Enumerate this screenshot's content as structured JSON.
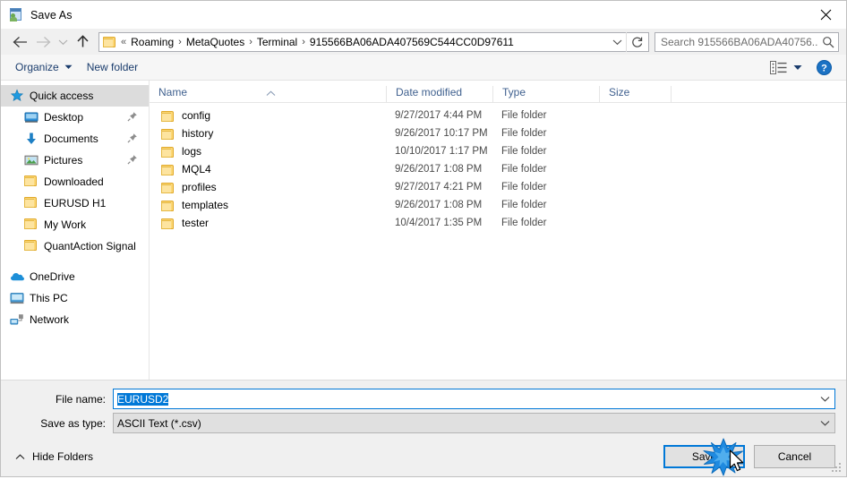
{
  "window": {
    "title": "Save As",
    "icon": "save-as-icon",
    "close_label": "✕"
  },
  "navigation": {
    "back_icon": "back-arrow-icon",
    "forward_icon": "forward-arrow-icon",
    "recent_icon": "chevron-down-icon",
    "up_icon": "up-arrow-icon",
    "folder_icon": "folder-icon",
    "breadcrumb": [
      {
        "label": "«",
        "type": "overflow"
      },
      {
        "label": "Roaming",
        "type": "crumb"
      },
      {
        "label": "MetaQuotes",
        "type": "crumb"
      },
      {
        "label": "Terminal",
        "type": "crumb"
      },
      {
        "label": "915566BA06ADA407569C544CC0D97611",
        "type": "crumb"
      }
    ],
    "dropdown_icon": "chevron-down-icon",
    "refresh_icon": "refresh-icon"
  },
  "search": {
    "placeholder": "Search 915566BA06ADA40756...",
    "icon": "search-icon"
  },
  "toolbar": {
    "organize_label": "Organize",
    "organize_icon": "chevron-down-icon",
    "new_folder_label": "New folder",
    "view_icon": "view-layout-icon",
    "view_chevron": "chevron-down-icon",
    "help_icon": "help-icon"
  },
  "sidebar": {
    "items": [
      {
        "label": "Quick access",
        "icon": "star-icon",
        "level": "root",
        "selected": true,
        "pinned": false
      },
      {
        "label": "Desktop",
        "icon": "desktop-icon",
        "level": "child",
        "selected": false,
        "pinned": true
      },
      {
        "label": "Documents",
        "icon": "documents-icon",
        "level": "child",
        "selected": false,
        "pinned": true
      },
      {
        "label": "Pictures",
        "icon": "pictures-icon",
        "level": "child",
        "selected": false,
        "pinned": true
      },
      {
        "label": "Downloaded",
        "icon": "folder-icon",
        "level": "child",
        "selected": false,
        "pinned": false
      },
      {
        "label": "EURUSD H1",
        "icon": "folder-icon",
        "level": "child",
        "selected": false,
        "pinned": false
      },
      {
        "label": "My Work",
        "icon": "folder-icon",
        "level": "child",
        "selected": false,
        "pinned": false
      },
      {
        "label": "QuantAction Signal",
        "icon": "folder-icon",
        "level": "child",
        "selected": false,
        "pinned": false
      },
      {
        "label": "OneDrive",
        "icon": "onedrive-icon",
        "level": "root",
        "selected": false,
        "pinned": false
      },
      {
        "label": "This PC",
        "icon": "thispc-icon",
        "level": "root",
        "selected": false,
        "pinned": false
      },
      {
        "label": "Network",
        "icon": "network-icon",
        "level": "root",
        "selected": false,
        "pinned": false
      }
    ]
  },
  "filelist": {
    "columns": [
      "Name",
      "Date modified",
      "Type",
      "Size"
    ],
    "sort_column": "Name",
    "sort_direction": "ascending",
    "rows": [
      {
        "name": "config",
        "date": "9/27/2017 4:44 PM",
        "type": "File folder",
        "size": "",
        "icon": "folder-icon"
      },
      {
        "name": "history",
        "date": "9/26/2017 10:17 PM",
        "type": "File folder",
        "size": "",
        "icon": "folder-icon"
      },
      {
        "name": "logs",
        "date": "10/10/2017 1:17 PM",
        "type": "File folder",
        "size": "",
        "icon": "folder-icon"
      },
      {
        "name": "MQL4",
        "date": "9/26/2017 1:08 PM",
        "type": "File folder",
        "size": "",
        "icon": "folder-icon"
      },
      {
        "name": "profiles",
        "date": "9/27/2017 4:21 PM",
        "type": "File folder",
        "size": "",
        "icon": "folder-icon"
      },
      {
        "name": "templates",
        "date": "9/26/2017 1:08 PM",
        "type": "File folder",
        "size": "",
        "icon": "folder-icon"
      },
      {
        "name": "tester",
        "date": "10/4/2017 1:35 PM",
        "type": "File folder",
        "size": "",
        "icon": "folder-icon"
      }
    ]
  },
  "form": {
    "filename_label": "File name:",
    "filename_value": "EURUSD2",
    "filename_selected": true,
    "filetype_label": "Save as type:",
    "filetype_value": "ASCII Text (*.csv)",
    "dropdown_icon": "chevron-down-icon"
  },
  "footer": {
    "hide_folders_label": "Hide Folders",
    "hide_folders_icon": "chevron-up-icon",
    "save_label": "Save",
    "cancel_label": "Cancel",
    "resize_grip_icon": "resize-grip-icon",
    "cursor_icon": "mouse-pointer-icon",
    "click_burst_icon": "click-burst-icon"
  },
  "colors": {
    "accent": "#0078d7",
    "selection": "#dcdcdc",
    "header_text": "#40618f",
    "folder_yellow": "#fcd775",
    "dialog_bg": "#f0f0f0"
  }
}
